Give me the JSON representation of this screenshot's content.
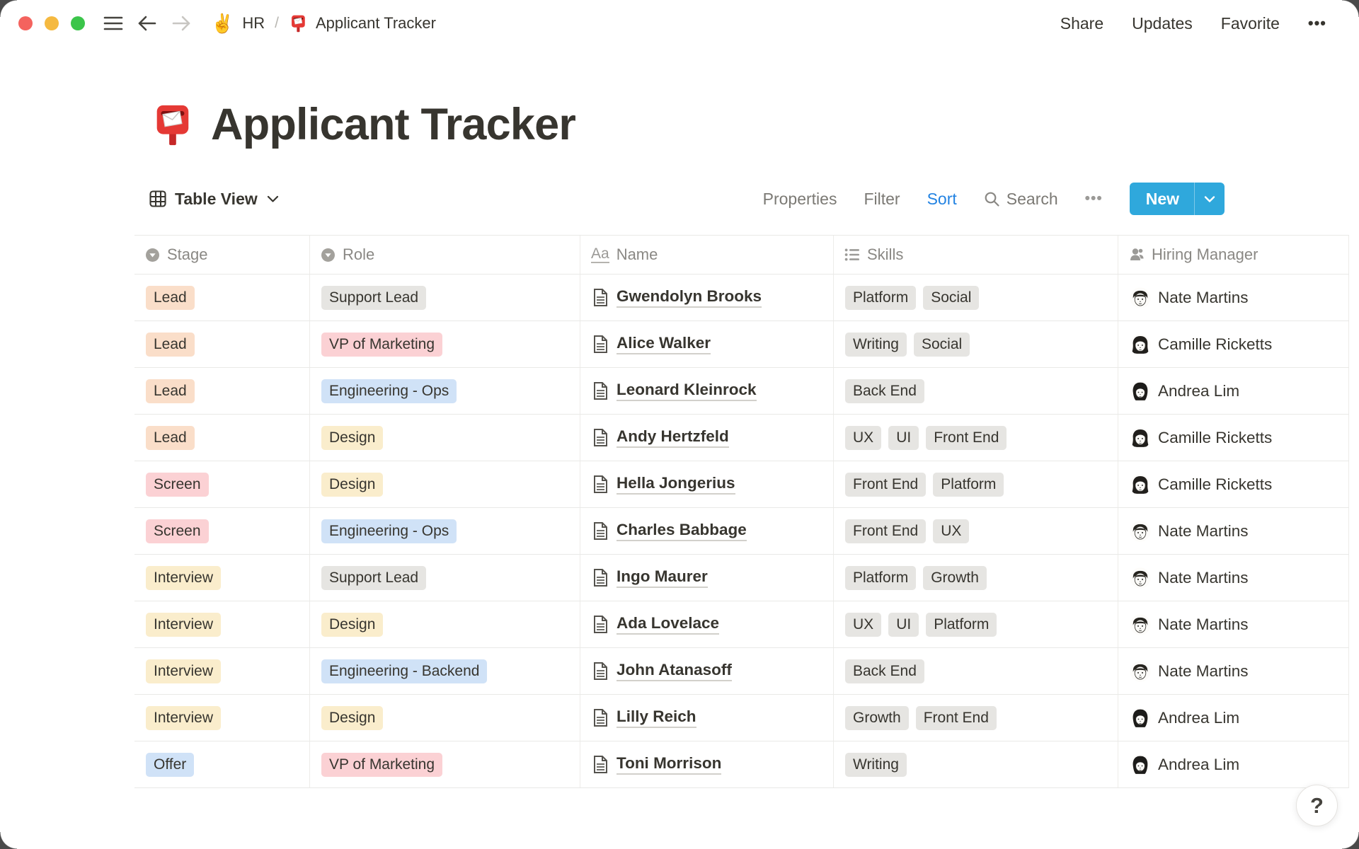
{
  "window": {
    "breadcrumb": {
      "workspace_emoji": "✌",
      "workspace": "HR",
      "separator": "/",
      "page": "Applicant Tracker"
    },
    "actions": {
      "share": "Share",
      "updates": "Updates",
      "favorite": "Favorite",
      "more": "•••"
    }
  },
  "page": {
    "title": "Applicant Tracker"
  },
  "toolbar": {
    "view_label": "Table View",
    "properties_label": "Properties",
    "filter_label": "Filter",
    "sort_label": "Sort",
    "search_label": "Search",
    "more_label": "•••",
    "new_label": "New"
  },
  "colors": {
    "accent_sort": "#2383E2",
    "new_button": "#2FA8DC",
    "tag_orange": "#FADEC9",
    "tag_red": "#FBD1D4",
    "tag_blue": "#D0E2F7",
    "tag_yellow": "#FAEDCC",
    "tag_gray": "#E6E5E2"
  },
  "table": {
    "columns": [
      {
        "label": "Stage",
        "icon": "select-icon"
      },
      {
        "label": "Role",
        "icon": "select-icon"
      },
      {
        "label": "Name",
        "icon": "text-icon"
      },
      {
        "label": "Skills",
        "icon": "list-icon"
      },
      {
        "label": "Hiring Manager",
        "icon": "person-icon"
      }
    ],
    "rows": [
      {
        "stage": {
          "label": "Lead",
          "color": "tag_orange"
        },
        "role": {
          "label": "Support Lead",
          "color": "tag_gray"
        },
        "name": "Gwendolyn Brooks",
        "skills": [
          "Platform",
          "Social"
        ],
        "manager": {
          "name": "Nate Martins",
          "avatar": "nate-martins-avatar"
        }
      },
      {
        "stage": {
          "label": "Lead",
          "color": "tag_orange"
        },
        "role": {
          "label": "VP of Marketing",
          "color": "tag_red"
        },
        "name": "Alice Walker",
        "skills": [
          "Writing",
          "Social"
        ],
        "manager": {
          "name": "Camille Ricketts",
          "avatar": "camille-ricketts-avatar"
        }
      },
      {
        "stage": {
          "label": "Lead",
          "color": "tag_orange"
        },
        "role": {
          "label": "Engineering - Ops",
          "color": "tag_blue"
        },
        "name": "Leonard Kleinrock",
        "skills": [
          "Back End"
        ],
        "manager": {
          "name": "Andrea Lim",
          "avatar": "andrea-lim-avatar"
        }
      },
      {
        "stage": {
          "label": "Lead",
          "color": "tag_orange"
        },
        "role": {
          "label": "Design",
          "color": "tag_yellow"
        },
        "name": "Andy Hertzfeld",
        "skills": [
          "UX",
          "UI",
          "Front End"
        ],
        "manager": {
          "name": "Camille Ricketts",
          "avatar": "camille-ricketts-avatar"
        }
      },
      {
        "stage": {
          "label": "Screen",
          "color": "tag_red"
        },
        "role": {
          "label": "Design",
          "color": "tag_yellow"
        },
        "name": "Hella Jongerius",
        "skills": [
          "Front End",
          "Platform"
        ],
        "manager": {
          "name": "Camille Ricketts",
          "avatar": "camille-ricketts-avatar"
        }
      },
      {
        "stage": {
          "label": "Screen",
          "color": "tag_red"
        },
        "role": {
          "label": "Engineering - Ops",
          "color": "tag_blue"
        },
        "name": "Charles Babbage",
        "skills": [
          "Front End",
          "UX"
        ],
        "manager": {
          "name": "Nate Martins",
          "avatar": "nate-martins-avatar"
        }
      },
      {
        "stage": {
          "label": "Interview",
          "color": "tag_yellow"
        },
        "role": {
          "label": "Support Lead",
          "color": "tag_gray"
        },
        "name": "Ingo Maurer",
        "skills": [
          "Platform",
          "Growth"
        ],
        "manager": {
          "name": "Nate Martins",
          "avatar": "nate-martins-avatar"
        }
      },
      {
        "stage": {
          "label": "Interview",
          "color": "tag_yellow"
        },
        "role": {
          "label": "Design",
          "color": "tag_yellow"
        },
        "name": "Ada Lovelace",
        "skills": [
          "UX",
          "UI",
          "Platform"
        ],
        "manager": {
          "name": "Nate Martins",
          "avatar": "nate-martins-avatar"
        }
      },
      {
        "stage": {
          "label": "Interview",
          "color": "tag_yellow"
        },
        "role": {
          "label": "Engineering - Backend",
          "color": "tag_blue"
        },
        "name": "John Atanasoff",
        "skills": [
          "Back End"
        ],
        "manager": {
          "name": "Nate Martins",
          "avatar": "nate-martins-avatar"
        }
      },
      {
        "stage": {
          "label": "Interview",
          "color": "tag_yellow"
        },
        "role": {
          "label": "Design",
          "color": "tag_yellow"
        },
        "name": "Lilly Reich",
        "skills": [
          "Growth",
          "Front End"
        ],
        "manager": {
          "name": "Andrea Lim",
          "avatar": "andrea-lim-avatar"
        }
      },
      {
        "stage": {
          "label": "Offer",
          "color": "tag_blue"
        },
        "role": {
          "label": "VP of Marketing",
          "color": "tag_red"
        },
        "name": "Toni Morrison",
        "skills": [
          "Writing"
        ],
        "manager": {
          "name": "Andrea Lim",
          "avatar": "andrea-lim-avatar"
        }
      }
    ]
  },
  "help_label": "?"
}
